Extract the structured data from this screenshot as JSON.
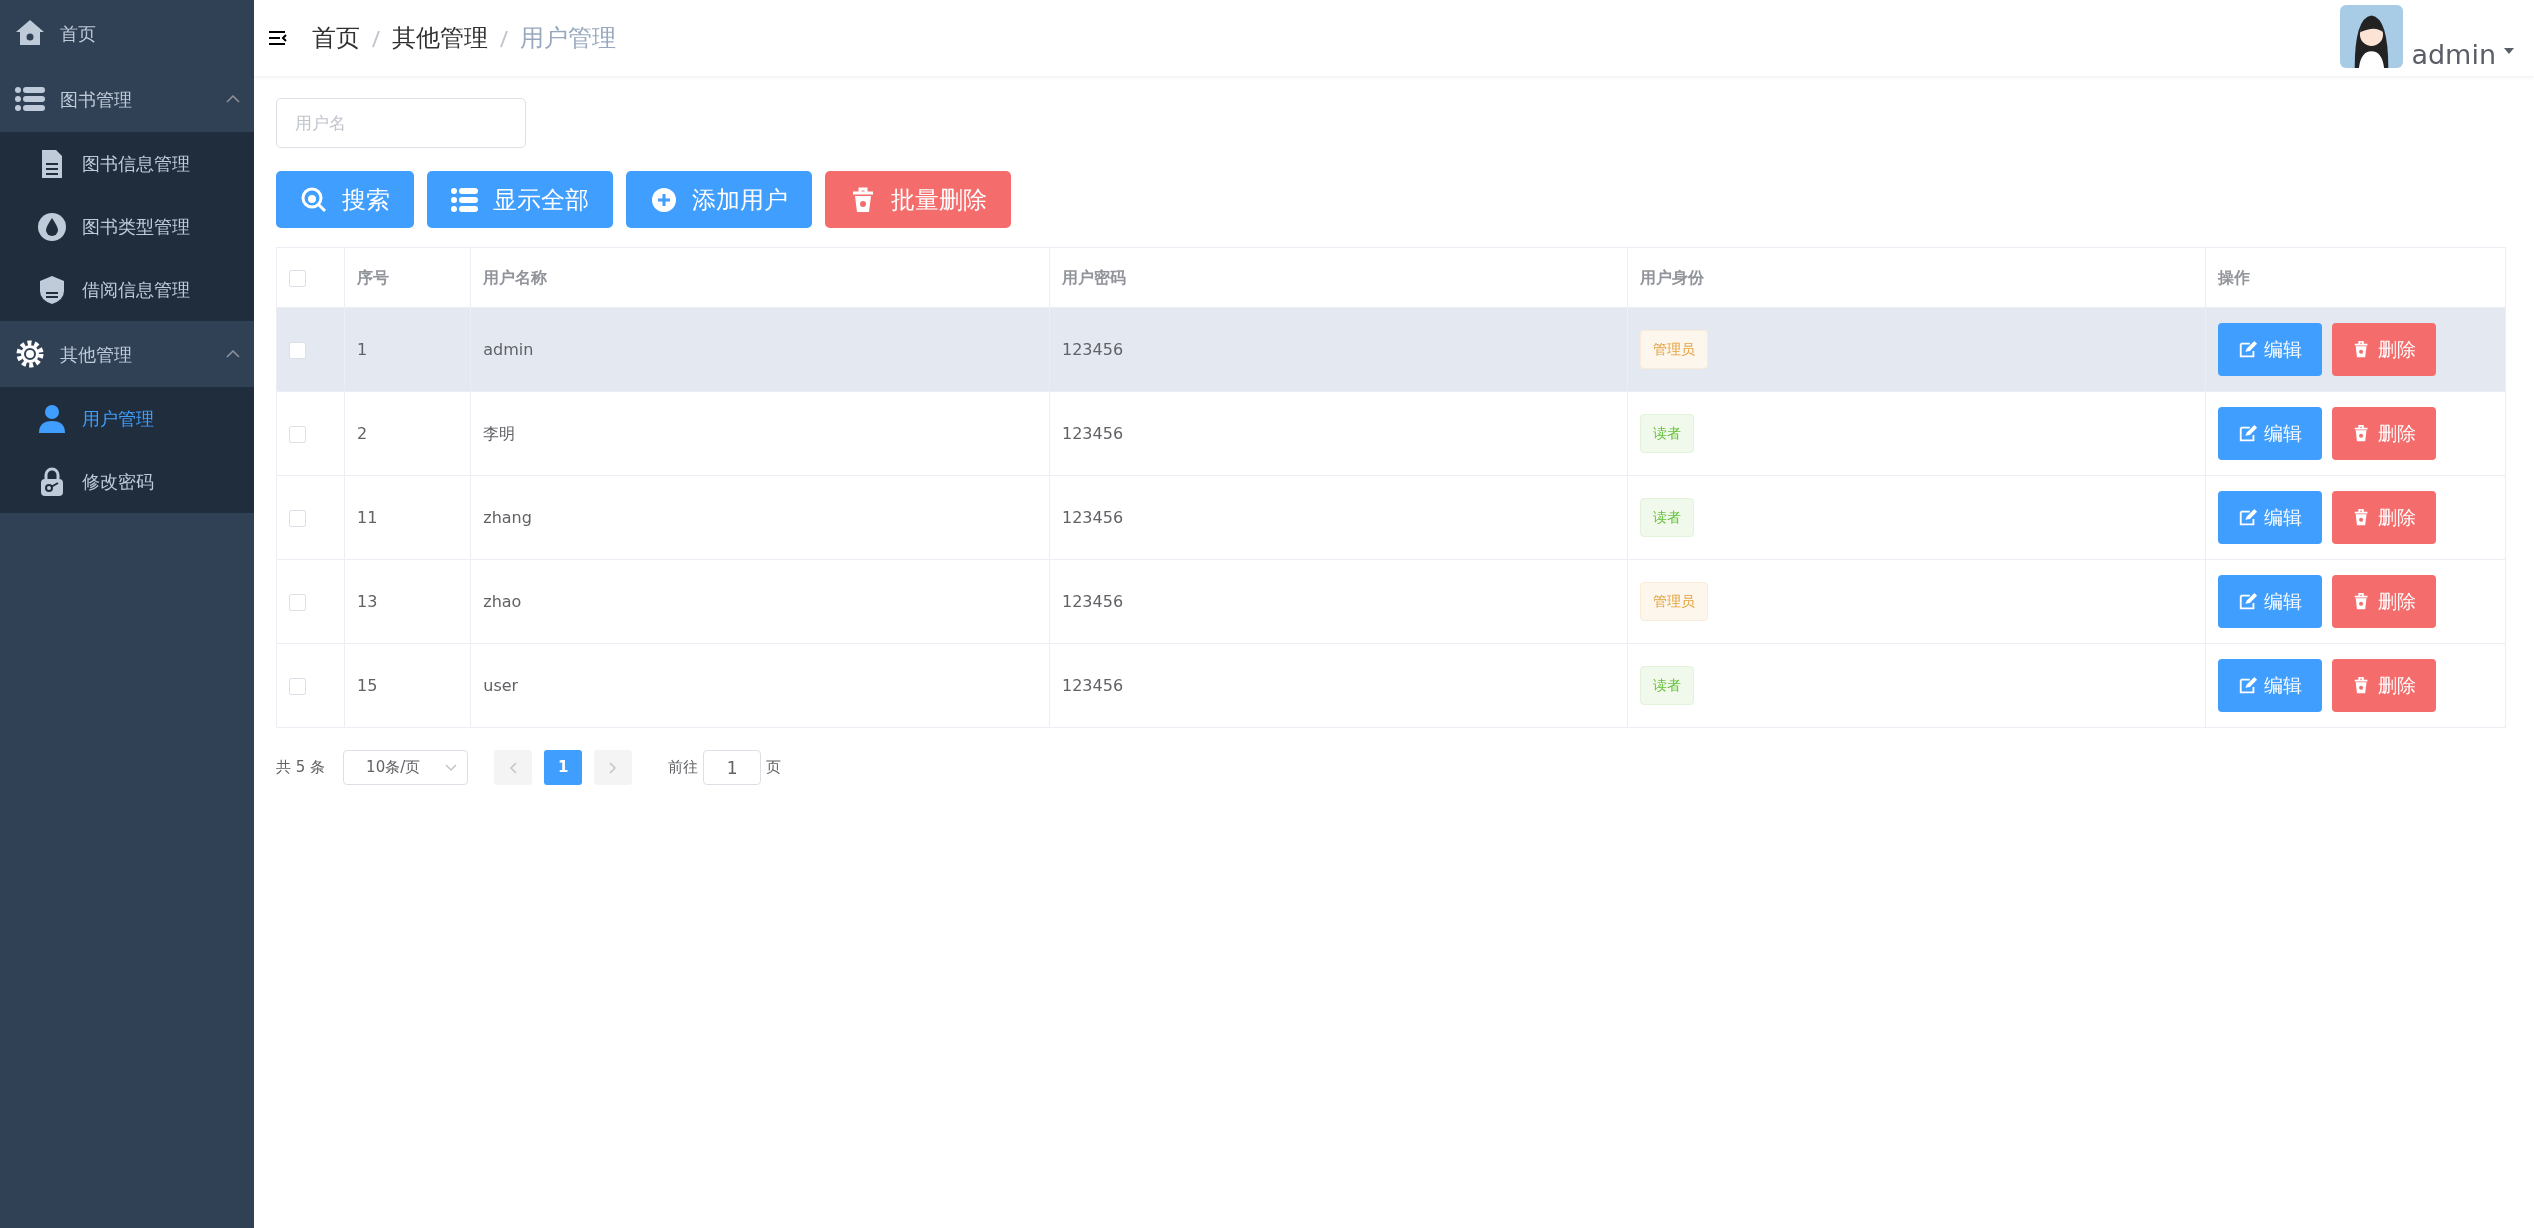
{
  "sidebar": {
    "items": [
      {
        "label": "首页",
        "kind": "leaf",
        "selected": false
      },
      {
        "label": "图书管理",
        "kind": "group",
        "expanded": true,
        "children": [
          {
            "label": "图书信息管理",
            "selected": false
          },
          {
            "label": "图书类型管理",
            "selected": false
          },
          {
            "label": "借阅信息管理",
            "selected": false
          }
        ]
      },
      {
        "label": "其他管理",
        "kind": "group",
        "expanded": true,
        "children": [
          {
            "label": "用户管理",
            "selected": true
          },
          {
            "label": "修改密码",
            "selected": false
          }
        ]
      }
    ]
  },
  "header": {
    "breadcrumb": [
      "首页",
      "其他管理",
      "用户管理"
    ],
    "user": {
      "name": "admin"
    }
  },
  "search": {
    "placeholder": "用户名"
  },
  "toolbar": [
    {
      "label": "搜索",
      "kind": "primary"
    },
    {
      "label": "显示全部",
      "kind": "primary"
    },
    {
      "label": "添加用户",
      "kind": "primary"
    },
    {
      "label": "批量删除",
      "kind": "danger"
    }
  ],
  "table": {
    "columns": [
      "序号",
      "用户名称",
      "用户密码",
      "用户身份",
      "操作"
    ],
    "header_checked": false,
    "rows": [
      {
        "checked": false,
        "hovered": true,
        "cells": [
          "1",
          "admin",
          "123456"
        ],
        "role": {
          "label": "管理员",
          "kind": "warning"
        },
        "actions": [
          "编辑",
          "删除"
        ]
      },
      {
        "checked": false,
        "hovered": false,
        "cells": [
          "2",
          "李明",
          "123456"
        ],
        "role": {
          "label": "读者",
          "kind": "success"
        },
        "actions": [
          "编辑",
          "删除"
        ]
      },
      {
        "checked": false,
        "hovered": false,
        "cells": [
          "11",
          "zhang",
          "123456"
        ],
        "role": {
          "label": "读者",
          "kind": "success"
        },
        "actions": [
          "编辑",
          "删除"
        ]
      },
      {
        "checked": false,
        "hovered": false,
        "cells": [
          "13",
          "zhao",
          "123456"
        ],
        "role": {
          "label": "管理员",
          "kind": "warning"
        },
        "actions": [
          "编辑",
          "删除"
        ]
      },
      {
        "checked": false,
        "hovered": false,
        "cells": [
          "15",
          "user",
          "123456"
        ],
        "role": {
          "label": "读者",
          "kind": "success"
        },
        "actions": [
          "编辑",
          "删除"
        ]
      }
    ]
  },
  "pagination": {
    "total": "共 5 条",
    "page_size": "10条/页",
    "pages": [
      {
        "label": "1",
        "selected": true
      }
    ],
    "goto_label": "前往",
    "goto_value": "1",
    "goto_suffix": "页"
  }
}
